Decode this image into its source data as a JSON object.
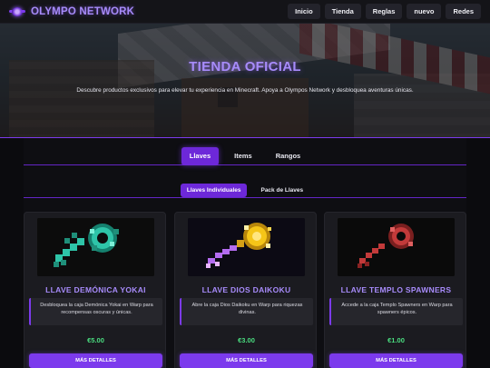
{
  "nav": {
    "brand": "OLYMPO NETWORK",
    "links": [
      "Inicio",
      "Tienda",
      "Reglas",
      "nuevo",
      "Redes"
    ]
  },
  "hero": {
    "title": "TIENDA OFICIAL",
    "subtitle": "Descubre productos exclusivos para elevar tu experiencia en Minecraft. Apoya a Olympos Network y desbloquea aventuras únicas."
  },
  "tabs": {
    "main": [
      "Llaves",
      "Items",
      "Rangos"
    ],
    "active_main": "Llaves",
    "sub": [
      "Llaves Individuales",
      "Pack de Llaves"
    ],
    "active_sub": "Llaves Individuales"
  },
  "products": [
    {
      "name": "LLAVE DEMÓNICA YOKAI",
      "description": "Desbloquea la caja Demónica Yokai en Warp para recompensas oscuras y únicas.",
      "price": "€5.00",
      "button": "MÁS DETALLES",
      "icon": "green-demonic-key-icon",
      "color": "#2ec4a8"
    },
    {
      "name": "LLAVE DIOS DAIKOKU",
      "description": "Abre la caja Dios Daikoku en Warp para riquezas divinas.",
      "price": "€3.00",
      "button": "MÁS DETALLES",
      "icon": "golden-divine-key-icon",
      "color": "#f5c518"
    },
    {
      "name": "LLAVE TEMPLO SPAWNERS",
      "description": "Accede a la caja Templo Spawners en Warp para spawners épicos.",
      "price": "€1.00",
      "button": "MÁS DETALLES",
      "icon": "red-temple-key-icon",
      "color": "#c23a3a"
    }
  ],
  "colors": {
    "accent": "#7c3aed",
    "brand": "#a78bfa",
    "price": "#4ade80",
    "background": "#0b0b0e"
  }
}
